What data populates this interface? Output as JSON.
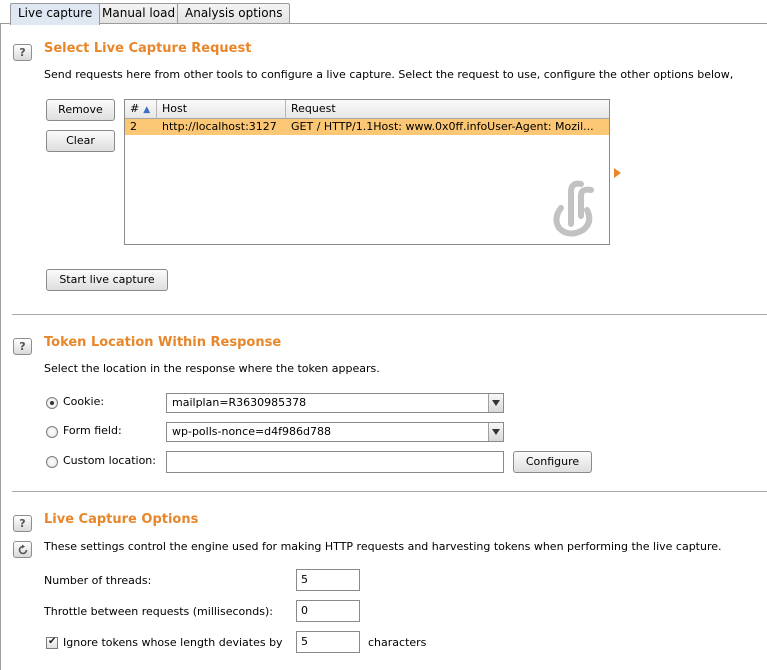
{
  "tabs": [
    {
      "label": "Live capture",
      "active": true
    },
    {
      "label": "Manual load",
      "active": false
    },
    {
      "label": "Analysis options",
      "active": false
    }
  ],
  "accent_color": "#e8862a",
  "selected_row_color": "#fbc774",
  "help_icon_text": "?",
  "select_request": {
    "title": "Select Live Capture Request",
    "description": "Send requests here from other tools to configure a live capture. Select the request to use, configure the other options below, ",
    "remove_label": "Remove",
    "clear_label": "Clear",
    "table": {
      "columns": [
        "#",
        "Host",
        "Request"
      ],
      "sort_indicator": "▲",
      "rows": [
        {
          "num": "2",
          "host": "http://localhost:3127",
          "request": "GET / HTTP/1.1Host: www.0x0ff.infoUser-Agent: Mozil..."
        }
      ]
    },
    "start_label": "Start live capture"
  },
  "token_location": {
    "title": "Token Location Within Response",
    "description": "Select the location in the response where the token appears.",
    "cookie_label": "Cookie:",
    "cookie_value": "mailplan=R3630985378",
    "form_field_label": "Form field:",
    "form_field_value": "wp-polls-nonce=d4f986d788",
    "custom_location_label": "Custom location:",
    "custom_location_value": "",
    "configure_label": "Configure",
    "selected": "cookie"
  },
  "live_capture_options": {
    "title": "Live Capture Options",
    "description": "These settings control the engine used for making HTTP requests and harvesting tokens when performing the live capture.",
    "threads_label": "Number of threads:",
    "threads_value": "5",
    "throttle_label": "Throttle between requests (milliseconds):",
    "throttle_value": "0",
    "ignore_label": "Ignore tokens whose length deviates by",
    "ignore_checked": true,
    "ignore_value": "5",
    "characters_label": "characters"
  }
}
